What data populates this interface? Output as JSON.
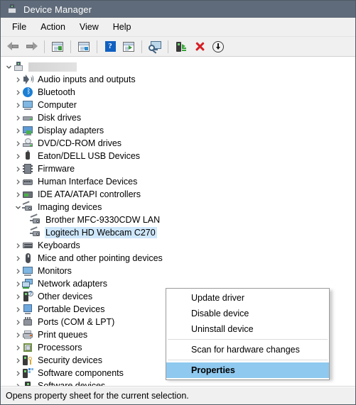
{
  "window": {
    "title": "Device Manager",
    "title_icon": "device-manager-icon"
  },
  "menubar": {
    "items": [
      {
        "label": "File",
        "name": "menu-file"
      },
      {
        "label": "Action",
        "name": "menu-action"
      },
      {
        "label": "View",
        "name": "menu-view"
      },
      {
        "label": "Help",
        "name": "menu-help"
      }
    ]
  },
  "toolbar": {
    "buttons": [
      {
        "name": "back-button",
        "icon": "back-arrow-icon"
      },
      {
        "name": "forward-button",
        "icon": "forward-arrow-icon"
      },
      {
        "name": "show-hide-console-tree-button",
        "icon": "console-tree-icon"
      },
      {
        "name": "properties-button",
        "icon": "properties-window-icon"
      },
      {
        "name": "help-button",
        "icon": "help-question-icon"
      },
      {
        "name": "show-hide-action-pane-button",
        "icon": "action-pane-icon"
      },
      {
        "name": "scan-for-hardware-changes-button",
        "icon": "scan-monitor-icon"
      },
      {
        "name": "update-driver-button",
        "icon": "update-driver-icon"
      },
      {
        "name": "uninstall-device-button",
        "icon": "red-x-icon"
      },
      {
        "name": "disable-device-button",
        "icon": "down-arrow-circle-icon"
      }
    ]
  },
  "tree": {
    "root": {
      "label": "",
      "redacted": true,
      "icon": "computer-icon",
      "expanded": true
    },
    "items": [
      {
        "label": "Audio inputs and outputs",
        "icon": "speaker-icon",
        "depth": 1,
        "expanded": false,
        "selected": false
      },
      {
        "label": "Bluetooth",
        "icon": "bluetooth-icon",
        "depth": 1,
        "expanded": false,
        "selected": false
      },
      {
        "label": "Computer",
        "icon": "monitor-icon",
        "depth": 1,
        "expanded": false,
        "selected": false
      },
      {
        "label": "Disk drives",
        "icon": "disk-drive-icon",
        "depth": 1,
        "expanded": false,
        "selected": false
      },
      {
        "label": "Display adapters",
        "icon": "display-adapter-icon",
        "depth": 1,
        "expanded": false,
        "selected": false
      },
      {
        "label": "DVD/CD-ROM drives",
        "icon": "dvd-drive-icon",
        "depth": 1,
        "expanded": false,
        "selected": false
      },
      {
        "label": "Eaton/DELL USB Devices",
        "icon": "usb-device-icon",
        "depth": 1,
        "expanded": false,
        "selected": false
      },
      {
        "label": "Firmware",
        "icon": "firmware-chip-icon",
        "depth": 1,
        "expanded": false,
        "selected": false
      },
      {
        "label": "Human Interface Devices",
        "icon": "hid-gamepad-icon",
        "depth": 1,
        "expanded": false,
        "selected": false
      },
      {
        "label": "IDE ATA/ATAPI controllers",
        "icon": "ide-controller-icon",
        "depth": 1,
        "expanded": false,
        "selected": false
      },
      {
        "label": "Imaging devices",
        "icon": "camera-icon",
        "depth": 1,
        "expanded": true,
        "selected": false
      },
      {
        "label": "Brother MFC-9330CDW LAN",
        "icon": "camera-icon",
        "depth": 2,
        "expanded": false,
        "selected": false
      },
      {
        "label": "Logitech HD Webcam C270",
        "icon": "camera-icon",
        "depth": 2,
        "expanded": false,
        "selected": true
      },
      {
        "label": "Keyboards",
        "icon": "keyboard-icon",
        "depth": 1,
        "expanded": false,
        "selected": false
      },
      {
        "label": "Mice and other pointing devices",
        "icon": "mouse-icon",
        "depth": 1,
        "expanded": false,
        "selected": false
      },
      {
        "label": "Monitors",
        "icon": "monitor-icon",
        "depth": 1,
        "expanded": false,
        "selected": false
      },
      {
        "label": "Network adapters",
        "icon": "network-adapter-icon",
        "depth": 1,
        "expanded": false,
        "selected": false
      },
      {
        "label": "Other devices",
        "icon": "other-device-icon",
        "depth": 1,
        "expanded": false,
        "selected": false
      },
      {
        "label": "Portable Devices",
        "icon": "portable-device-icon",
        "depth": 1,
        "expanded": false,
        "selected": false
      },
      {
        "label": "Ports (COM & LPT)",
        "icon": "port-icon",
        "depth": 1,
        "expanded": false,
        "selected": false
      },
      {
        "label": "Print queues",
        "icon": "printer-icon",
        "depth": 1,
        "expanded": false,
        "selected": false
      },
      {
        "label": "Processors",
        "icon": "processor-icon",
        "depth": 1,
        "expanded": false,
        "selected": false
      },
      {
        "label": "Security devices",
        "icon": "security-device-icon",
        "depth": 1,
        "expanded": false,
        "selected": false
      },
      {
        "label": "Software components",
        "icon": "software-component-icon",
        "depth": 1,
        "expanded": false,
        "selected": false
      },
      {
        "label": "Software devices",
        "icon": "software-device-icon",
        "depth": 1,
        "expanded": false,
        "selected": false
      }
    ]
  },
  "context_menu": {
    "items": [
      {
        "label": "Update driver",
        "name": "ctx-update-driver",
        "type": "item",
        "highlighted": false
      },
      {
        "label": "Disable device",
        "name": "ctx-disable-device",
        "type": "item",
        "highlighted": false
      },
      {
        "label": "Uninstall device",
        "name": "ctx-uninstall-device",
        "type": "item",
        "highlighted": false
      },
      {
        "label": "",
        "name": "ctx-separator-1",
        "type": "separator",
        "highlighted": false
      },
      {
        "label": "Scan for hardware changes",
        "name": "ctx-scan-hardware",
        "type": "item",
        "highlighted": false
      },
      {
        "label": "",
        "name": "ctx-separator-2",
        "type": "separator",
        "highlighted": false
      },
      {
        "label": "Properties",
        "name": "ctx-properties",
        "type": "item",
        "highlighted": true
      }
    ]
  },
  "statusbar": {
    "text": "Opens property sheet for the current selection."
  },
  "colors": {
    "titlebar": "#5f6b7a",
    "chrome": "#f0f0f0",
    "selection": "#cfe7fb",
    "menu_highlight": "#8fc9ef",
    "accent_red": "#d61f26",
    "accent_green": "#3da33d",
    "accent_blue": "#1b7fd4"
  }
}
